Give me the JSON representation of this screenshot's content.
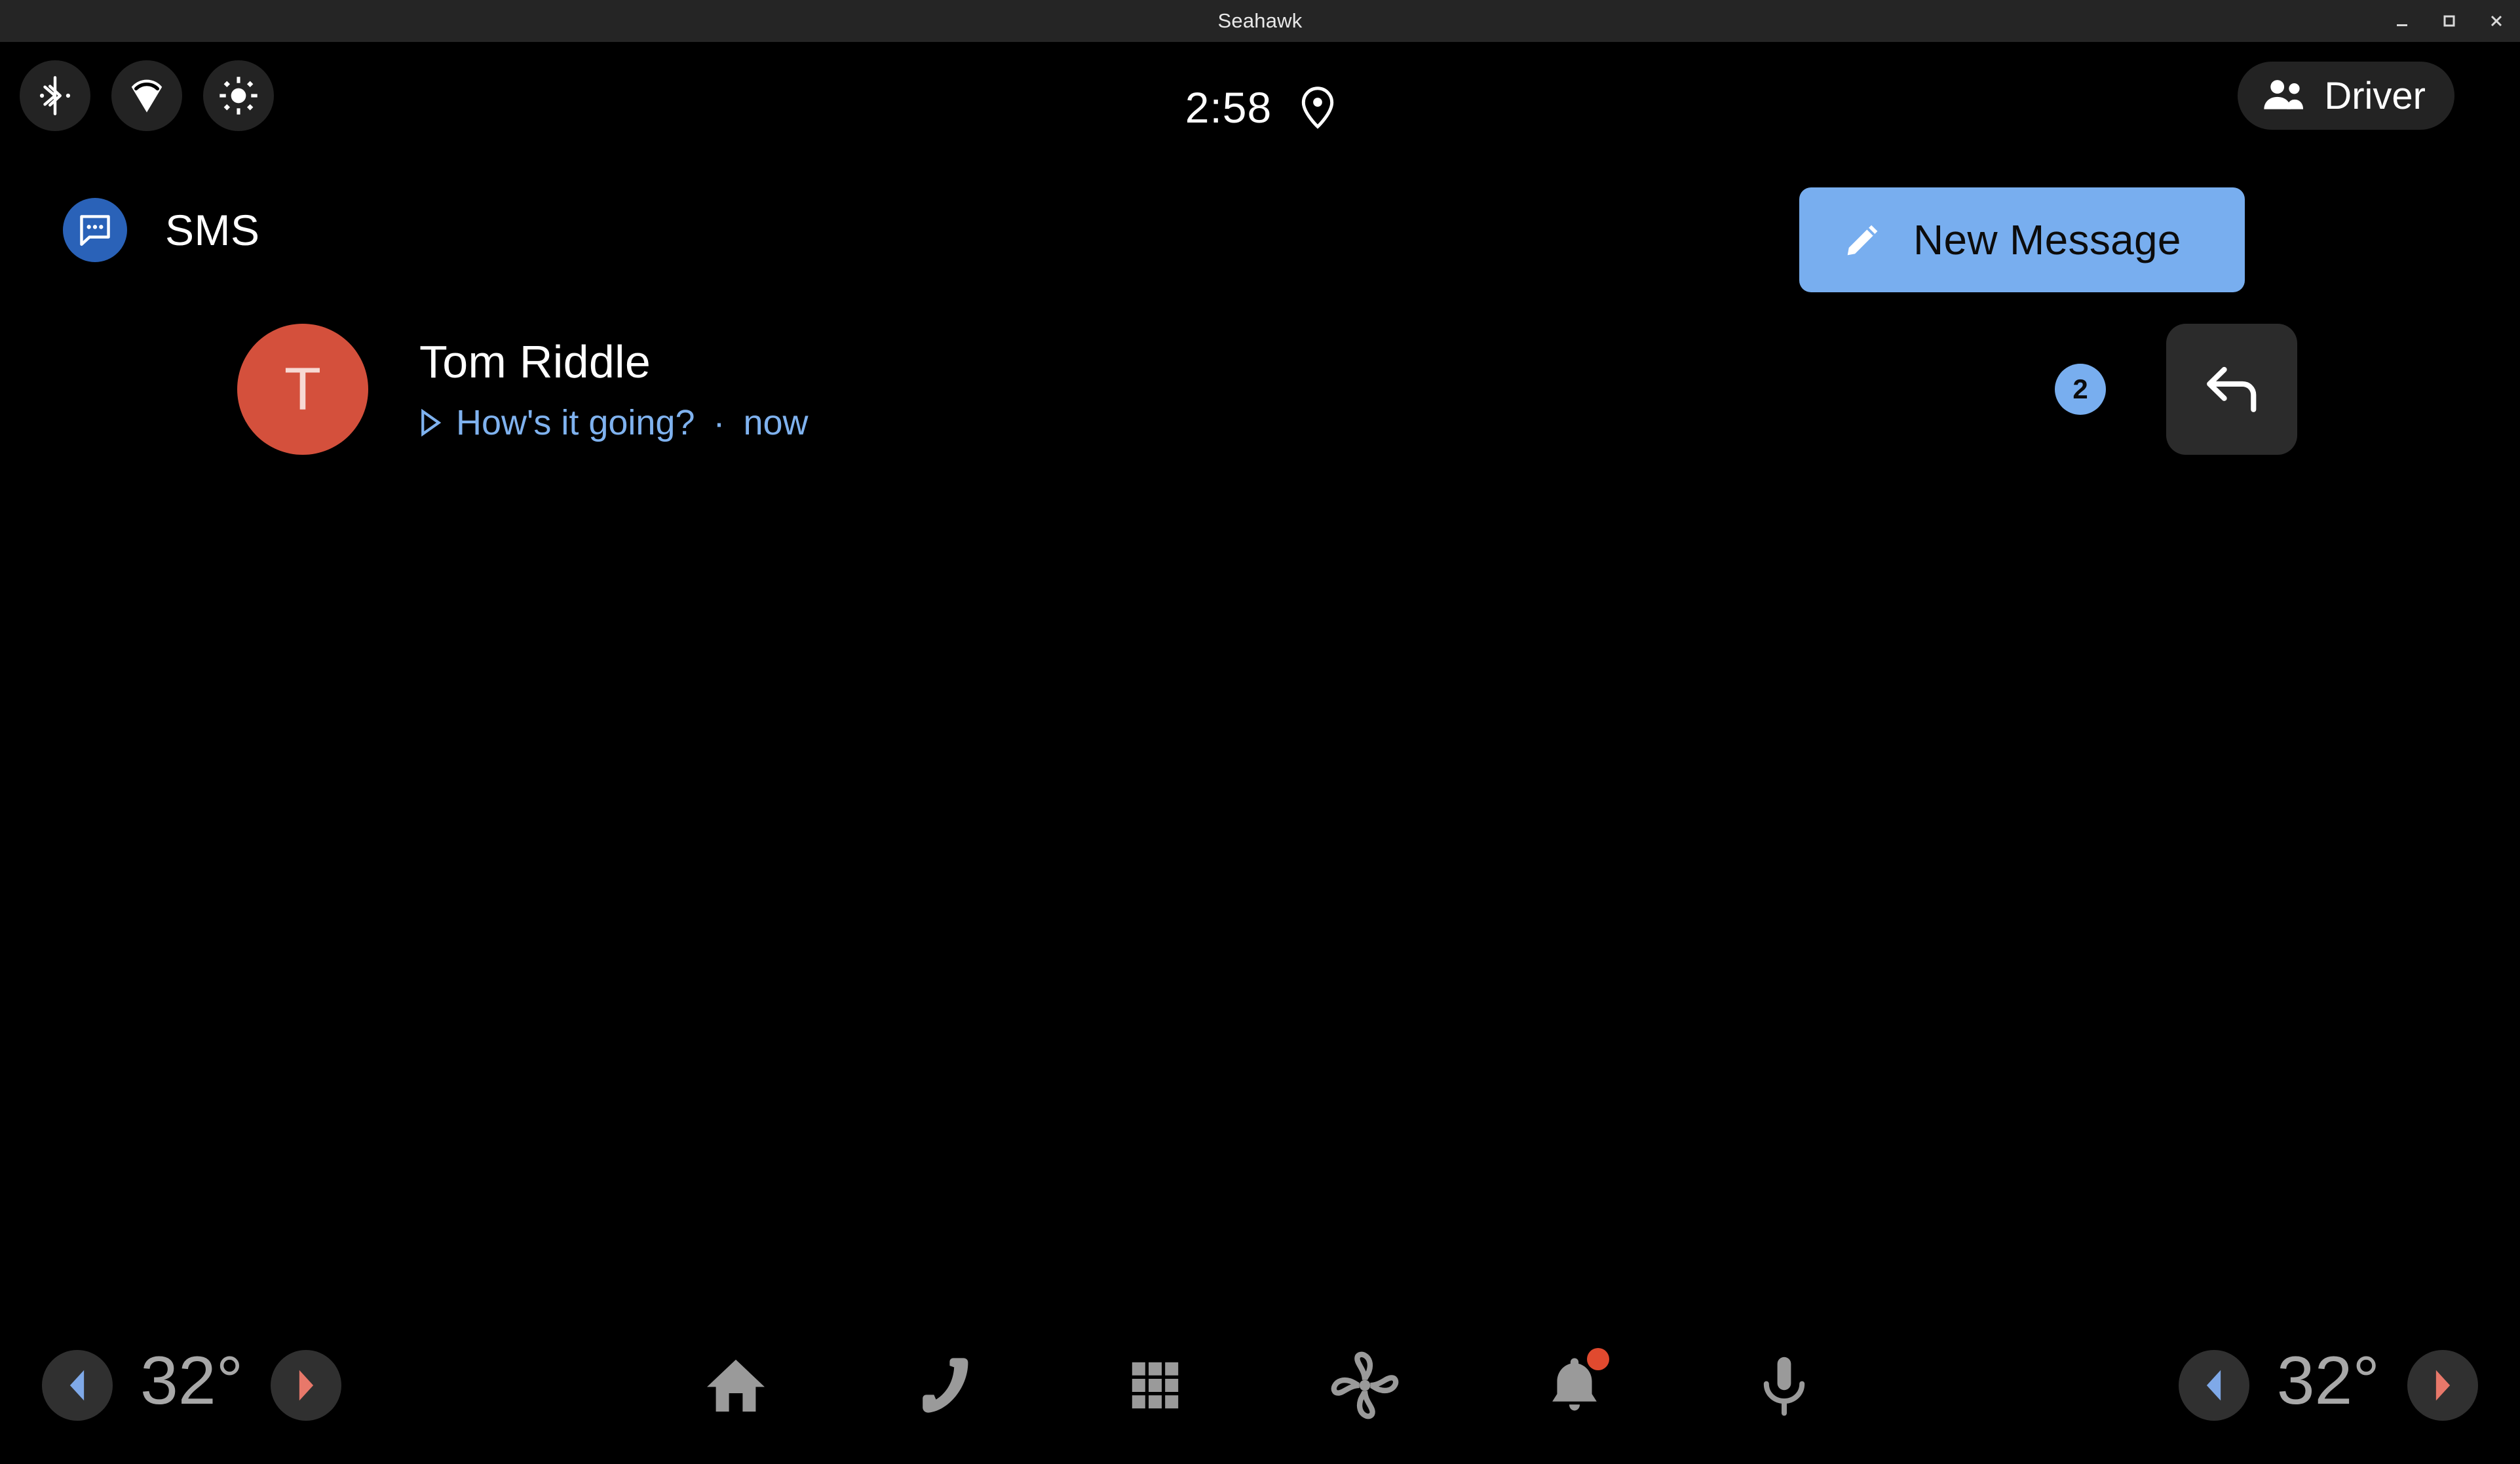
{
  "window": {
    "title": "Seahawk",
    "controls": [
      {
        "name": "minimize",
        "glyph": "minimize-icon"
      },
      {
        "name": "maximize",
        "glyph": "maximize-icon"
      },
      {
        "name": "close",
        "glyph": "close-icon"
      }
    ]
  },
  "statusbar": {
    "left_icons": [
      {
        "name": "bluetooth-icon",
        "label": "Bluetooth"
      },
      {
        "name": "wifi-icon",
        "label": "Wi-Fi"
      },
      {
        "name": "brightness-icon",
        "label": "Brightness"
      }
    ],
    "clock": "2:58",
    "location_icon": "location-pin-icon",
    "profile": {
      "label": "Driver",
      "icon": "people-icon"
    }
  },
  "app": {
    "icon": "sms-chat-icon",
    "title": "SMS",
    "new_message": {
      "label": "New Message",
      "icon": "pencil-icon",
      "bg": "#78AEEF",
      "fg": "#0c0c0c"
    }
  },
  "conversations": [
    {
      "avatar_letter": "T",
      "avatar_color": "#D4503C",
      "name": "Tom Riddle",
      "preview": "How's it going?",
      "separator": "·",
      "timestamp": "now",
      "play_icon": "play-triangle-icon",
      "unread_count": "2",
      "reply_icon": "reply-arrow-icon"
    }
  ],
  "navbar": {
    "temp_left": {
      "decrease_icon": "triangle-left-icon",
      "value": "32°",
      "increase_icon": "triangle-right-icon"
    },
    "temp_right": {
      "decrease_icon": "triangle-left-icon",
      "value": "32°",
      "increase_icon": "triangle-right-icon"
    },
    "items": [
      {
        "name": "home-icon",
        "label": "Home",
        "badge": false
      },
      {
        "name": "phone-icon",
        "label": "Phone",
        "badge": false
      },
      {
        "name": "apps-grid-icon",
        "label": "Apps",
        "badge": false
      },
      {
        "name": "fan-climate-icon",
        "label": "Climate",
        "badge": false
      },
      {
        "name": "bell-notification-icon",
        "label": "Notifications",
        "badge": true
      },
      {
        "name": "microphone-icon",
        "label": "Assistant",
        "badge": false
      }
    ]
  },
  "colors": {
    "background": "#000000",
    "titlebar": "#252525",
    "pill": "#232323",
    "accent_blue": "#78AEEF",
    "app_icon_blue": "#2A62B8",
    "avatar_red": "#D4503C",
    "nav_icon_gray": "#9A9A9A",
    "temp_text_gray": "#A8A8A8",
    "notif_red": "#E04A2F",
    "arrow_cool_blue": "#7FA9E8",
    "arrow_warm_red": "#E8786A"
  }
}
